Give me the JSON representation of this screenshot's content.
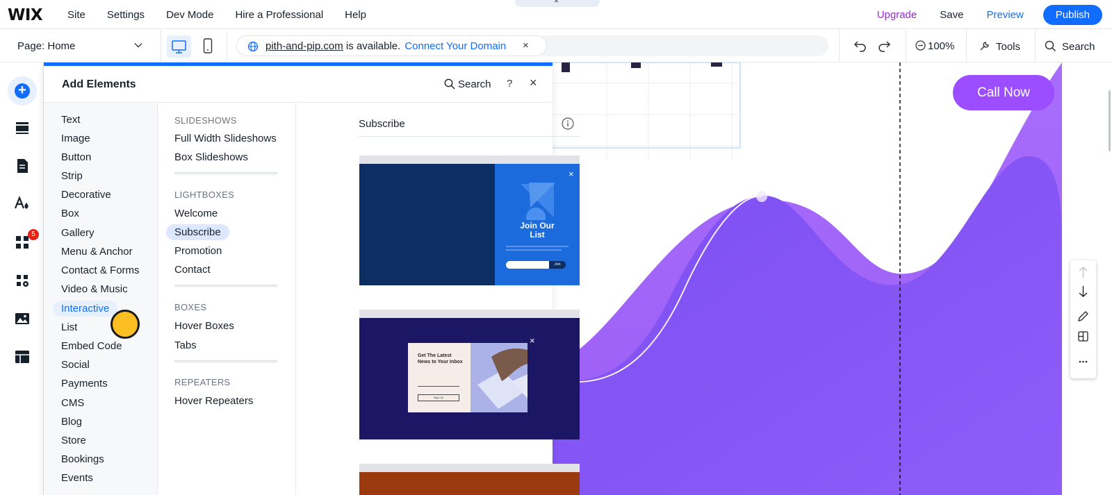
{
  "topbar": {
    "logo": "WIX",
    "menu": [
      "Site",
      "Settings",
      "Dev Mode",
      "Hire a Professional",
      "Help"
    ],
    "upgrade": "Upgrade",
    "save": "Save",
    "preview": "Preview",
    "publish": "Publish",
    "tab_handle_x": "×"
  },
  "toolbar": {
    "page_selector": "Page: Home",
    "domain_name": "pith-and-pip.com",
    "domain_status": "is available.",
    "domain_connect": "Connect Your Domain",
    "domain_close": "×",
    "zoom": "100%",
    "tools": "Tools",
    "search": "Search"
  },
  "rail": {
    "badge_count": "5"
  },
  "panel": {
    "title": "Add Elements",
    "search": "Search",
    "help": "?",
    "close": "×",
    "categories": [
      "Text",
      "Image",
      "Button",
      "Strip",
      "Decorative",
      "Box",
      "Gallery",
      "Menu & Anchor",
      "Contact & Forms",
      "Video & Music",
      "Interactive",
      "List",
      "Embed Code",
      "Social",
      "Payments",
      "CMS",
      "Blog",
      "Store",
      "Bookings",
      "Events"
    ],
    "active_category": "Interactive",
    "sections": {
      "slideshows": {
        "title": "SLIDESHOWS",
        "items": [
          "Full Width Slideshows",
          "Box Slideshows"
        ]
      },
      "lightboxes": {
        "title": "LIGHTBOXES",
        "items": [
          "Welcome",
          "Subscribe",
          "Promotion",
          "Contact"
        ]
      },
      "boxes": {
        "title": "BOXES",
        "items": [
          "Hover Boxes",
          "Tabs"
        ]
      },
      "repeaters": {
        "title": "REPEATERS",
        "items": [
          "Hover Repeaters"
        ]
      }
    },
    "active_item": "Subscribe",
    "preview_title": "Subscribe",
    "card1": {
      "heading": "Join Our List",
      "close": "×",
      "button": "Join"
    },
    "card2": {
      "heading": "Get The Latest News to Your Inbox",
      "close": "×",
      "button": "Sign Up"
    }
  },
  "canvas": {
    "call_now": "Call Now"
  },
  "colors": {
    "accent": "#116dff",
    "upgrade": "#9a27d5",
    "canvas_purple": "#8b5cf6",
    "call_now": "#9b4dff"
  }
}
